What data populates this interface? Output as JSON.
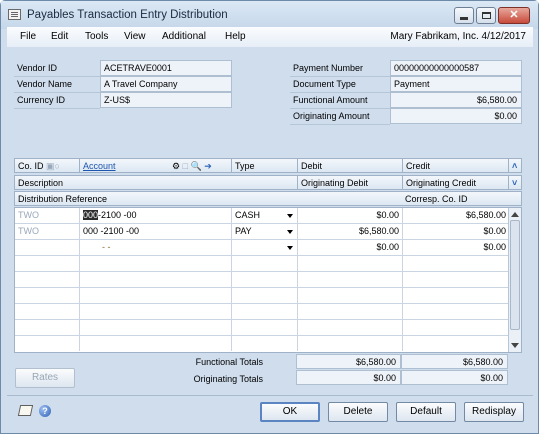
{
  "window": {
    "title": "Payables Transaction Entry Distribution"
  },
  "menu": {
    "items": [
      "File",
      "Edit",
      "Tools",
      "View",
      "Additional",
      "Help"
    ],
    "user_info": "Mary  Fabrikam, Inc.  4/12/2017"
  },
  "header": {
    "vendor_id_label": "Vendor ID",
    "vendor_id": "ACETRAVE0001",
    "vendor_name_label": "Vendor Name",
    "vendor_name": "A Travel Company",
    "currency_id_label": "Currency ID",
    "currency_id": "Z-US$",
    "payment_number_label": "Payment Number",
    "payment_number": "00000000000000587",
    "document_type_label": "Document Type",
    "document_type": "Payment",
    "functional_amount_label": "Functional Amount",
    "functional_amount": "$6,580.00",
    "originating_amount_label": "Originating Amount",
    "originating_amount": "$0.00"
  },
  "grid": {
    "headers": {
      "co_id": "Co. ID",
      "account": "Account",
      "type": "Type",
      "debit": "Debit",
      "credit": "Credit",
      "description": "Description",
      "originating_debit": "Originating Debit",
      "originating_credit": "Originating Credit",
      "distribution_reference": "Distribution Reference",
      "corresp_co_id": "Corresp. Co. ID"
    },
    "rows": [
      {
        "co_id": "TWO",
        "account_selected": "000",
        "account_rest": "-2100 -00",
        "type": "CASH",
        "debit": "$0.00",
        "credit": "$6,580.00"
      },
      {
        "co_id": "TWO",
        "account_selected": "",
        "account_rest": "000 -2100 -00",
        "type": "PAY",
        "debit": "$6,580.00",
        "credit": "$0.00"
      },
      {
        "co_id": "",
        "account_selected": "",
        "account_rest": "-       -",
        "type": "",
        "debit": "$0.00",
        "credit": "$0.00"
      }
    ]
  },
  "totals": {
    "functional_label": "Functional Totals",
    "functional_debit": "$6,580.00",
    "functional_credit": "$6,580.00",
    "originating_label": "Originating Totals",
    "originating_debit": "$0.00",
    "originating_credit": "$0.00"
  },
  "buttons": {
    "rates": "Rates",
    "ok": "OK",
    "delete": "Delete",
    "default": "Default",
    "redisplay": "Redisplay"
  },
  "colors": {
    "window_bg": "#cfdded",
    "link": "#1f56b0",
    "close_button": "#c74a3b"
  }
}
